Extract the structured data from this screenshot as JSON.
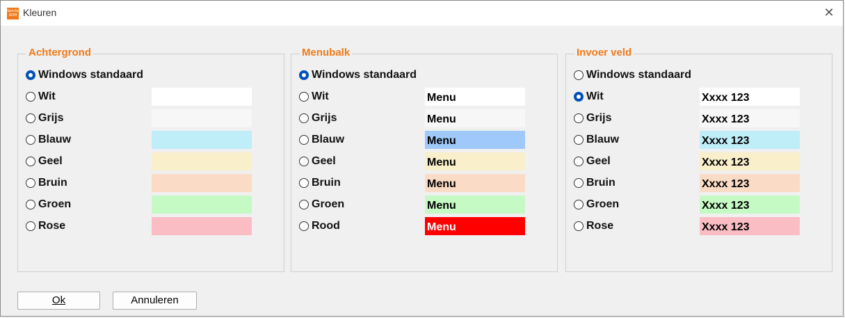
{
  "window": {
    "title": "Kleuren",
    "icon_text": "Sportadm ADM",
    "close_symbol": "✕"
  },
  "groups": [
    {
      "title": "Achtergrond",
      "options": [
        {
          "label": "Windows standaard",
          "checked": true
        },
        {
          "label": "Wit",
          "checked": false,
          "swatch_color": "#ffffff",
          "swatch_text": ""
        },
        {
          "label": "Grijs",
          "checked": false,
          "swatch_color": "#f7f7f7",
          "swatch_text": ""
        },
        {
          "label": "Blauw",
          "checked": false,
          "swatch_color": "#bfeef9",
          "swatch_text": ""
        },
        {
          "label": "Geel",
          "checked": false,
          "swatch_color": "#f9efcb",
          "swatch_text": ""
        },
        {
          "label": "Bruin",
          "checked": false,
          "swatch_color": "#fadcc6",
          "swatch_text": ""
        },
        {
          "label": "Groen",
          "checked": false,
          "swatch_color": "#c6fac4",
          "swatch_text": ""
        },
        {
          "label": "Rose",
          "checked": false,
          "swatch_color": "#fbbdc4",
          "swatch_text": ""
        }
      ]
    },
    {
      "title": "Menubalk",
      "options": [
        {
          "label": "Windows standaard",
          "checked": true
        },
        {
          "label": "Wit",
          "checked": false,
          "swatch_color": "#ffffff",
          "swatch_text": "Menu"
        },
        {
          "label": "Grijs",
          "checked": false,
          "swatch_color": "#f7f7f7",
          "swatch_text": "Menu"
        },
        {
          "label": "Blauw",
          "checked": false,
          "swatch_color": "#9ec9fa",
          "swatch_text": "Menu"
        },
        {
          "label": "Geel",
          "checked": false,
          "swatch_color": "#f9efcb",
          "swatch_text": "Menu"
        },
        {
          "label": "Bruin",
          "checked": false,
          "swatch_color": "#fadcc6",
          "swatch_text": "Menu"
        },
        {
          "label": "Groen",
          "checked": false,
          "swatch_color": "#c6fac4",
          "swatch_text": "Menu"
        },
        {
          "label": "Rood",
          "checked": false,
          "swatch_color": "#ff0000",
          "swatch_text": "Menu",
          "text_color": "#ffffff"
        }
      ]
    },
    {
      "title": "Invoer veld",
      "options": [
        {
          "label": "Windows standaard",
          "checked": false
        },
        {
          "label": "Wit",
          "checked": true,
          "swatch_color": "#ffffff",
          "swatch_text": "Xxxx 123"
        },
        {
          "label": "Grijs",
          "checked": false,
          "swatch_color": "#f7f7f7",
          "swatch_text": "Xxxx 123"
        },
        {
          "label": "Blauw",
          "checked": false,
          "swatch_color": "#bfeef9",
          "swatch_text": "Xxxx 123"
        },
        {
          "label": "Geel",
          "checked": false,
          "swatch_color": "#f9efcb",
          "swatch_text": "Xxxx 123"
        },
        {
          "label": "Bruin",
          "checked": false,
          "swatch_color": "#fadcc6",
          "swatch_text": "Xxxx 123"
        },
        {
          "label": "Groen",
          "checked": false,
          "swatch_color": "#c6fac4",
          "swatch_text": "Xxxx 123"
        },
        {
          "label": "Rose",
          "checked": false,
          "swatch_color": "#fbbdc4",
          "swatch_text": "Xxxx 123"
        }
      ]
    }
  ],
  "buttons": {
    "ok_label": "Ok",
    "cancel_label": "Annuleren"
  }
}
